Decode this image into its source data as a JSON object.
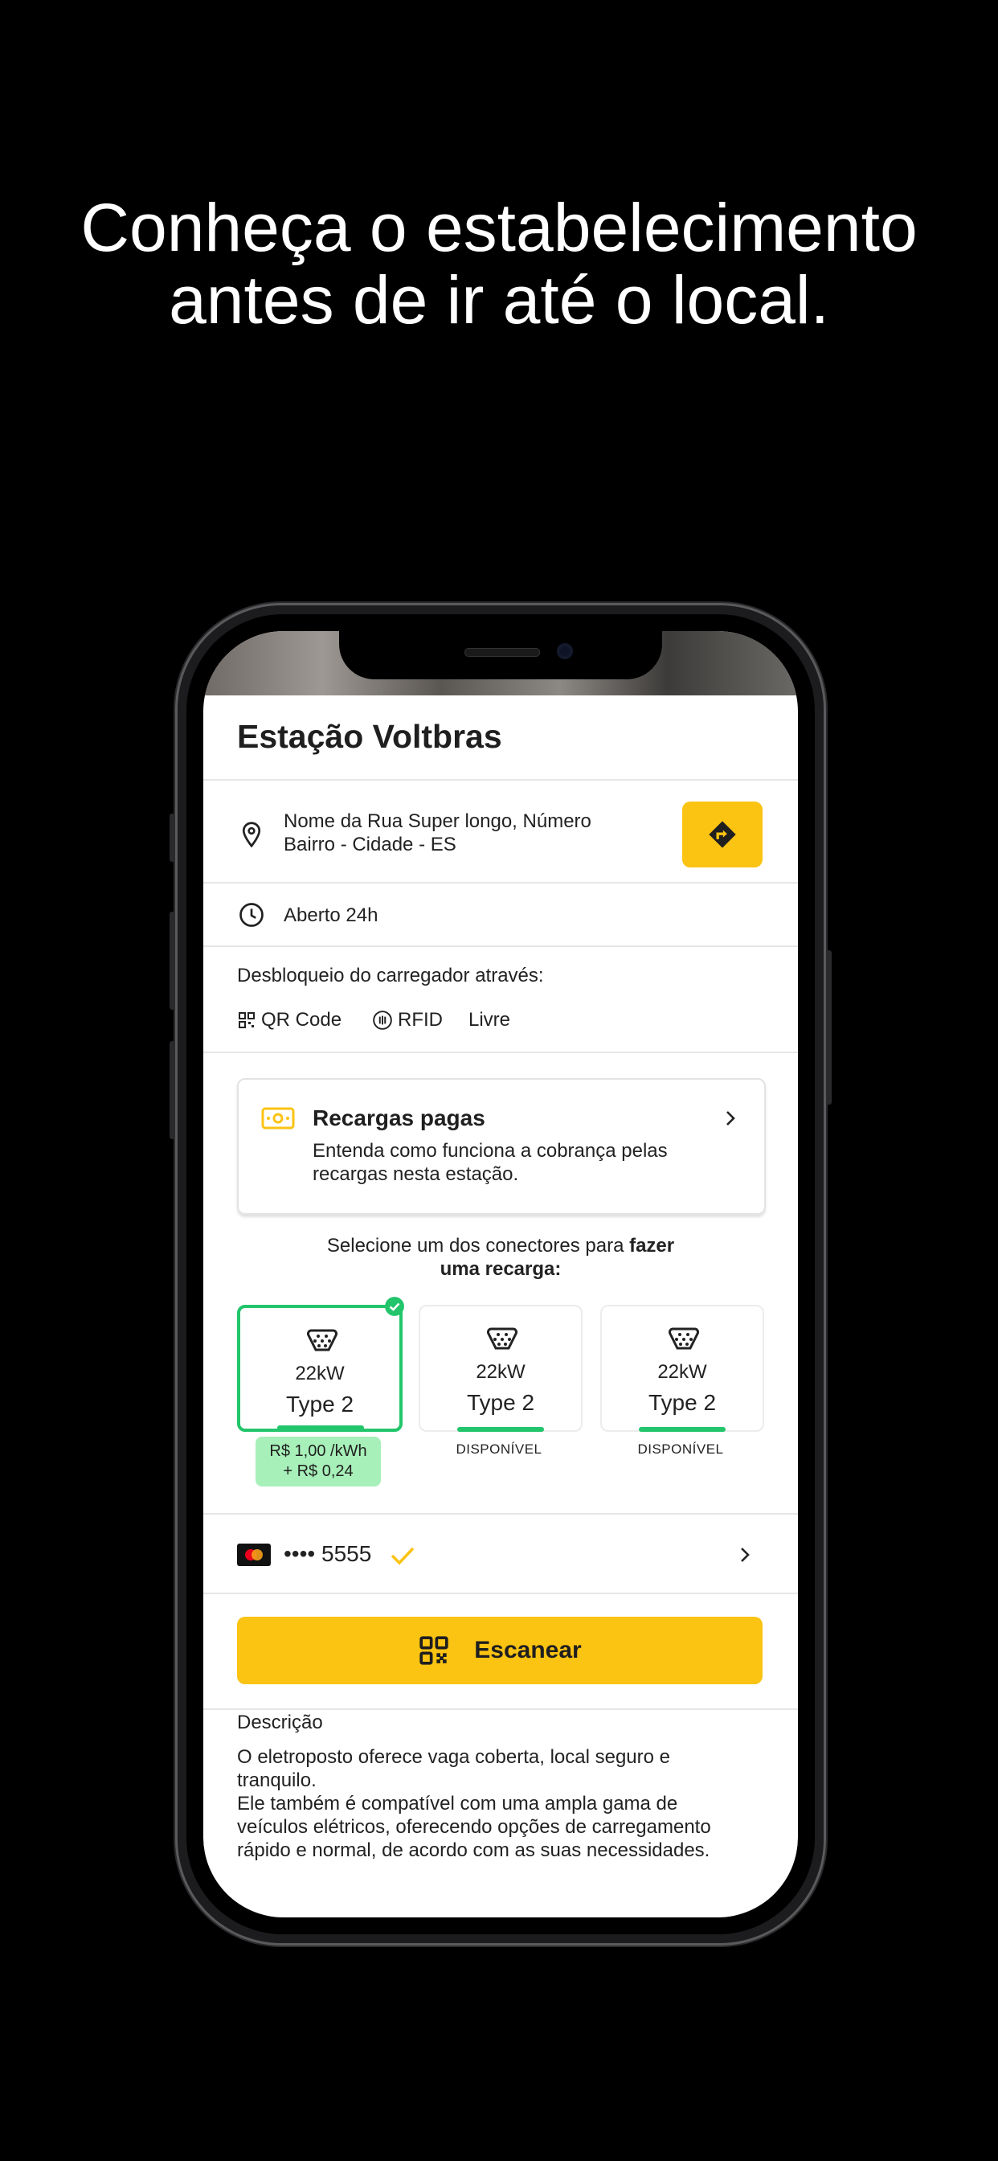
{
  "headline": {
    "line1": "Conheça o estabelecimento",
    "line2": "antes de ir até o local."
  },
  "station": {
    "name": "Estação Voltbras",
    "address_line1": "Nome da Rua Super longo, Número",
    "address_line2": "Bairro - Cidade - ES",
    "hours": "Aberto 24h",
    "unlock_label": "Desbloqueio do carregador através:",
    "unlock_options": [
      "QR Code",
      "RFID",
      "Livre"
    ]
  },
  "paid_card": {
    "title": "Recargas pagas",
    "description": "Entenda como funciona a cobrança pelas recargas nesta estação."
  },
  "connector_prompt": {
    "text": "Selecione um dos conectores para ",
    "bold1": "fazer",
    "bold2": "uma recarga:"
  },
  "connectors": [
    {
      "power": "22kW",
      "type": "Type 2",
      "price_line1": "R$ 1,00 /kWh",
      "price_line2": "+ R$ 0,24",
      "selected": true
    },
    {
      "power": "22kW",
      "type": "Type 2",
      "status": "DISPONÍVEL",
      "selected": false
    },
    {
      "power": "22kW",
      "type": "Type 2",
      "status": "DISPONÍVEL",
      "selected": false
    }
  ],
  "payment": {
    "masked": "•••• 5555"
  },
  "scan_button": {
    "label": "Escanear"
  },
  "description": {
    "label": "Descrição",
    "text1": "O eletroposto oferece vaga coberta, local seguro e tranquilo.",
    "text2": "Ele também é compatível com uma ampla gama de veículos elétricos, oferecendo opções de carregamento rápido e normal, de acordo com as suas necessidades."
  },
  "colors": {
    "accent": "#fbc312",
    "available": "#22c56b",
    "price_bg": "#a7f0b9"
  }
}
